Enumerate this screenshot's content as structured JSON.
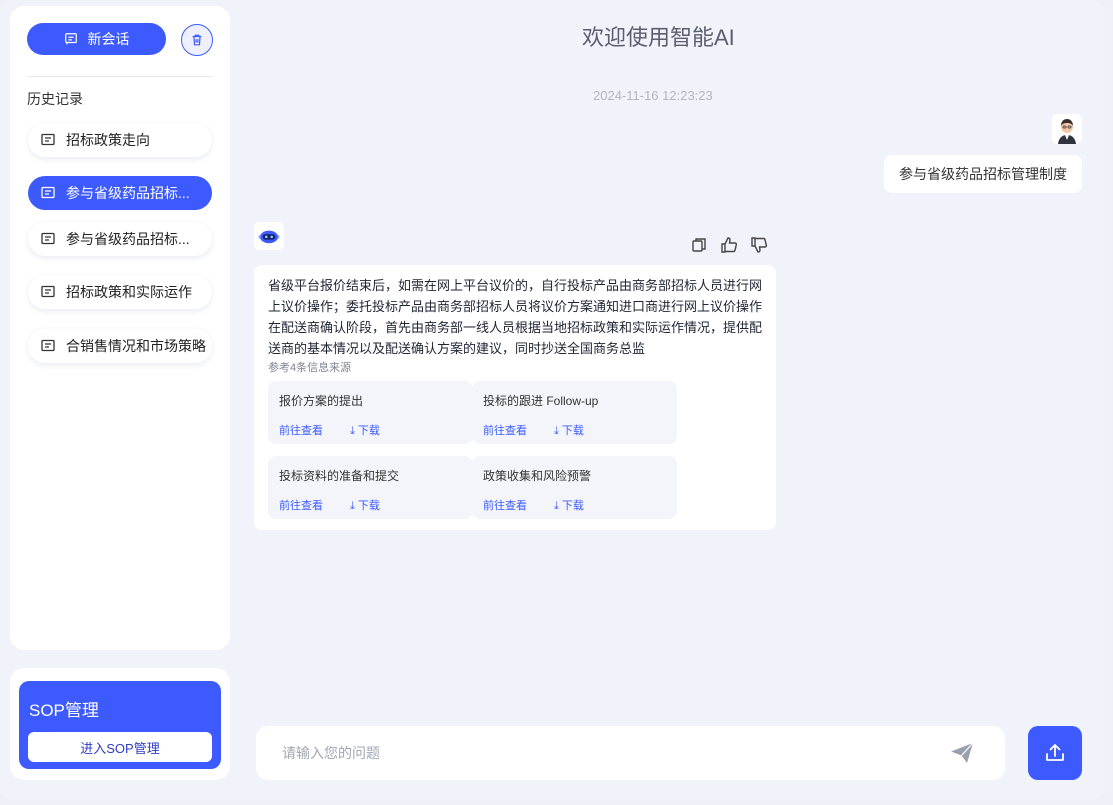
{
  "colors": {
    "accent": "#3d5afe",
    "background": "#f1f3fa"
  },
  "sidebar": {
    "new_chat_label": "新会话",
    "history_title": "历史记录",
    "items": [
      {
        "label": "招标政策走向",
        "active": false
      },
      {
        "label": "参与省级药品招标...",
        "active": true
      },
      {
        "label": "参与省级药品招标...",
        "active": false
      },
      {
        "label": "招标政策和实际运作",
        "active": false
      },
      {
        "label": "合销售情况和市场策略",
        "active": false
      }
    ],
    "icons": {
      "new_chat": "chat-icon",
      "trash": "trash-icon",
      "item": "chat-icon"
    }
  },
  "sop": {
    "title": "SOP管理",
    "button_label": "进入SOP管理"
  },
  "main": {
    "title": "欢迎使用智能AI",
    "timestamp": "2024-11-16 12:23:23",
    "user_message": "参与省级药品招标管理制度",
    "answer": "省级平台报价结束后，如需在网上平台议价的，自行投标产品由商务部招标人员进行网上议价操作；委托投标产品由商务部招标人员将议价方案通知进口商进行网上议价操作在配送商确认阶段，首先由商务部一线人员根据当地招标政策和实际运作情况，提供配送商的基本情况以及配送确认方案的建议，同时抄送全国商务总监",
    "ref_label": "参考4条信息来源",
    "references": [
      {
        "title": "报价方案的提出",
        "view": "前往查看",
        "download": "下载"
      },
      {
        "title": "投标的跟进 Follow-up",
        "view": "前往查看",
        "download": "下载"
      },
      {
        "title": "投标资料的准备和提交",
        "view": "前往查看",
        "download": "下载"
      },
      {
        "title": "政策收集和风险预警",
        "view": "前往查看",
        "download": "下载"
      }
    ],
    "action_icons": [
      "copy-icon",
      "thumbs-up-icon",
      "thumbs-down-icon"
    ]
  },
  "input": {
    "placeholder": "请输入您的问题",
    "value": ""
  }
}
